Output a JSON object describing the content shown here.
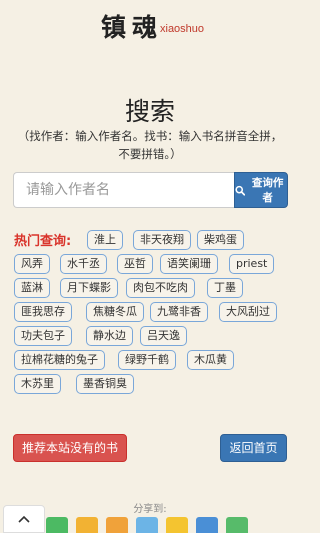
{
  "logo": {
    "cn": "镇魂",
    "en": "xiaoshuo"
  },
  "title": "搜索",
  "hint": "（找作者：输入作者名。找书：输入书名拼音全拼，不要拼错。）",
  "search": {
    "placeholder": "请输入作者名",
    "value": "",
    "button_label": "查询作者"
  },
  "hot": {
    "label": "热门查询:",
    "tags": [
      "淮上",
      "非天夜翔",
      "柴鸡蛋",
      "风弄",
      "水千丞",
      "巫哲",
      "语笑阑珊",
      "priest",
      "蓝淋",
      "月下蝶影",
      "肉包不吃肉",
      "丁墨",
      "匪我思存",
      "焦糖冬瓜",
      "九鹭非香",
      "大风刮过",
      "功夫包子",
      "静水边",
      "吕天逸",
      "拉棉花糖的兔子",
      "绿野千鹤",
      "木瓜黄",
      "木苏里",
      "墨香铜臭"
    ]
  },
  "buttons": {
    "recommend": "推荐本站没有的书",
    "home": "返回首页"
  },
  "share": {
    "label": "分享到:",
    "colors": [
      "#4cba63",
      "#f2b233",
      "#f0a23a",
      "#6cb4e6",
      "#f4c430",
      "#4a8fd6",
      "#57bb6a"
    ]
  },
  "colors": {
    "accent_blue": "#3a76b4",
    "accent_red": "#d9534f",
    "hot_red": "#d9342b",
    "background": "#f5f0e4"
  }
}
